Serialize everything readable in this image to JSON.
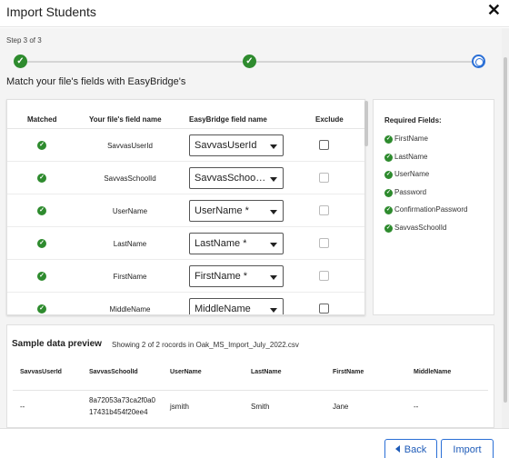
{
  "dialog": {
    "title": "Import Students",
    "close_label": "✕"
  },
  "stepper": {
    "step_text": "Step 3 of 3",
    "steps": [
      {
        "status": "done",
        "icon": "check-icon"
      },
      {
        "status": "done",
        "icon": "check-icon"
      },
      {
        "status": "current",
        "icon": "target-icon"
      }
    ],
    "done_glyph": "✓"
  },
  "mapping": {
    "title": "Match your file's fields with EasyBridge's",
    "headers": {
      "matched": "Matched",
      "file_field": "Your file's field name",
      "easybridge_field": "EasyBridge field name",
      "exclude": "Exclude"
    },
    "rows": [
      {
        "file_field": "SavvasUserId",
        "easybridge_field": "SavvasUserId",
        "exclude_enabled": true
      },
      {
        "file_field": "SavvasSchoolId",
        "easybridge_field": "SavvasSchoolI...",
        "exclude_enabled": false
      },
      {
        "file_field": "UserName",
        "easybridge_field": "UserName *",
        "exclude_enabled": false
      },
      {
        "file_field": "LastName",
        "easybridge_field": "LastName *",
        "exclude_enabled": false
      },
      {
        "file_field": "FirstName",
        "easybridge_field": "FirstName *",
        "exclude_enabled": false
      },
      {
        "file_field": "MiddleName",
        "easybridge_field": "MiddleName",
        "exclude_enabled": true
      }
    ]
  },
  "required": {
    "title": "Required Fields:",
    "items": [
      "FirstName",
      "LastName",
      "UserName",
      "Password",
      "ConfirmationPassword",
      "SavvasSchoolId"
    ]
  },
  "sample": {
    "title": "Sample data preview",
    "caption": "Showing 2 of 2 rocords in Oak_MS_Import_July_2022.csv",
    "columns": [
      "SavvasUserId",
      "SavvasSchoolId",
      "UserName",
      "LastName",
      "FirstName",
      "MiddleName"
    ],
    "row": {
      "savvas_user_id": "--",
      "school_id_line1": "8a72053a73ca2f0a0",
      "school_id_line2": "17431b454f20ee4",
      "username": "jsmith",
      "lastname": "Smith",
      "firstname": "Jane",
      "middlename": "--"
    }
  },
  "footer": {
    "back_label": "Back",
    "import_label": "Import"
  },
  "colors": {
    "success": "#2e8b2e",
    "accent": "#2a6fd6"
  }
}
